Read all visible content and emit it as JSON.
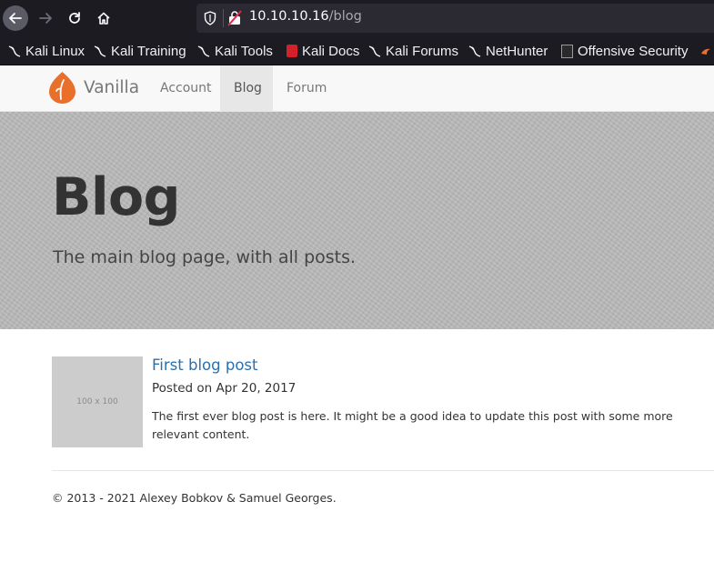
{
  "browser": {
    "url_host": "10.10.10.16",
    "url_path": "/blog",
    "bookmarks": [
      {
        "label": "Kali Linux",
        "icon": "kali-dragon-icon"
      },
      {
        "label": "Kali Training",
        "icon": "kali-dragon-icon"
      },
      {
        "label": "Kali Tools",
        "icon": "kali-dragon-icon"
      },
      {
        "label": "Kali Docs",
        "icon": "kali-docs-icon"
      },
      {
        "label": "Kali Forums",
        "icon": "kali-dragon-icon"
      },
      {
        "label": "NetHunter",
        "icon": "kali-dragon-icon"
      },
      {
        "label": "Offensive Security",
        "icon": "offsec-icon"
      }
    ]
  },
  "navbar": {
    "brand": "Vanilla",
    "links": [
      {
        "label": "Account",
        "active": false
      },
      {
        "label": "Blog",
        "active": true
      },
      {
        "label": "Forum",
        "active": false
      }
    ]
  },
  "hero": {
    "title": "Blog",
    "subtitle": "The main blog page, with all posts."
  },
  "posts": [
    {
      "thumbnail_label": "100 x 100",
      "title": "First blog post",
      "date": "Posted on Apr 20, 2017",
      "body": "The first ever blog post is here. It might be a good idea to update this post with some more relevant content."
    }
  ],
  "footer": {
    "text": "© 2013 - 2021 Alexey Bobkov & Samuel Georges."
  },
  "colors": {
    "chrome_bg": "#1c1b22",
    "urlbar_bg": "#2b2a33",
    "brand_orange": "#e8702a",
    "link_blue": "#2a6fb0",
    "hero_bg": "#b9b9b9"
  }
}
